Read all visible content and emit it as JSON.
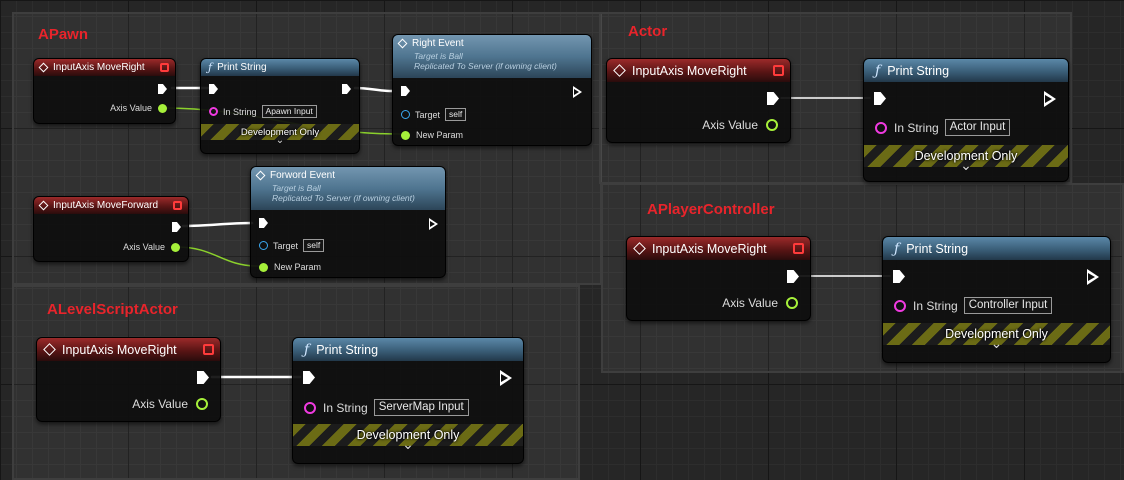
{
  "comments": {
    "apawn": "APawn",
    "actor": "Actor",
    "aplayercontroller": "APlayerController",
    "alevelscriptactor": "ALevelScriptActor"
  },
  "nodes": {
    "apawn_input_moveright": {
      "title": "InputAxis MoveRight",
      "axis_value": "Axis Value"
    },
    "apawn_print_string": {
      "title": "Print String",
      "in_string_label": "In String",
      "in_string_value": "Apawn Input",
      "dev_only": "Development Only"
    },
    "right_event": {
      "title": "Right Event",
      "sub1": "Target is Ball",
      "sub2": "Replicated To Server (if owning client)",
      "target_label": "Target",
      "target_value": "self",
      "param_label": "New Param"
    },
    "apawn_input_moveforward": {
      "title": "InputAxis MoveForward",
      "axis_value": "Axis Value"
    },
    "forword_event": {
      "title": "Forword Event",
      "sub1": "Target is Ball",
      "sub2": "Replicated To Server (if owning client)",
      "target_label": "Target",
      "target_value": "self",
      "param_label": "New Param"
    },
    "actor_input_moveright": {
      "title": "InputAxis MoveRight",
      "axis_value": "Axis Value"
    },
    "actor_print_string": {
      "title": "Print String",
      "in_string_label": "In String",
      "in_string_value": "Actor Input",
      "dev_only": "Development Only"
    },
    "pc_input_moveright": {
      "title": "InputAxis MoveRight",
      "axis_value": "Axis Value"
    },
    "pc_print_string": {
      "title": "Print String",
      "in_string_label": "In String",
      "in_string_value": "Controller Input",
      "dev_only": "Development Only"
    },
    "lsa_input_moveright": {
      "title": "InputAxis MoveRight",
      "axis_value": "Axis Value"
    },
    "lsa_print_string": {
      "title": "Print String",
      "in_string_label": "In String",
      "in_string_value": "ServerMap Input",
      "dev_only": "Development Only"
    }
  },
  "icons": {
    "function": "ƒ",
    "chevron": "⌄"
  },
  "colors": {
    "comment_title": "#e8242b",
    "float_pin": "#a6f03a",
    "string_pin": "#f03ae0",
    "object_pin": "#3aa8f0",
    "event_header": "#9c2a2a",
    "function_header": "#3a5e78"
  }
}
